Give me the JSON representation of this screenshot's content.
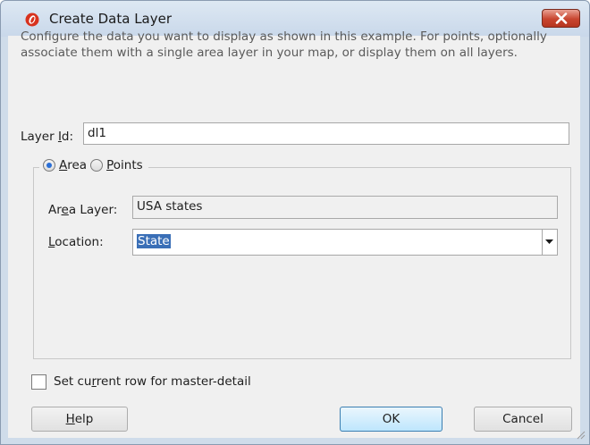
{
  "window": {
    "title": "Create Data Layer",
    "icon": "oracle-app-icon",
    "close_icon": "close-icon"
  },
  "description": "Configure the data you want to display as shown in this example. For points, optionally associate them with a single area layer in your map, or display them on all layers.",
  "layer_id": {
    "label_pre": "Layer ",
    "label_mnemonic": "I",
    "label_post": "d:",
    "value": "dl1"
  },
  "type_radios": {
    "selected": "Area",
    "area": {
      "mnemonic": "A",
      "rest": "rea"
    },
    "points": {
      "mnemonic": "P",
      "rest": "oints"
    }
  },
  "area_layer": {
    "label_pre": "Ar",
    "label_mnemonic": "e",
    "label_post": "a Layer:",
    "value": "USA states"
  },
  "location": {
    "label_mnemonic": "L",
    "label_post": "ocation:",
    "value": "State"
  },
  "master_detail": {
    "label_pre": "Set cu",
    "label_mnemonic": "r",
    "label_post": "rent row for master-detail",
    "checked": false
  },
  "buttons": {
    "help": {
      "mnemonic": "H",
      "rest": "elp"
    },
    "ok": "OK",
    "cancel": "Cancel"
  },
  "colors": {
    "accent": "#3a6fb7",
    "close": "#c8452f",
    "titlebar": "#cfdcea"
  }
}
